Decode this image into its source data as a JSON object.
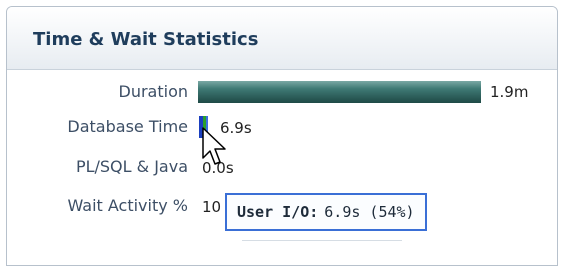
{
  "panel": {
    "title": "Time & Wait Statistics",
    "rows": [
      {
        "label": "Duration",
        "value": "1.9m",
        "bar_fraction": 1.0
      },
      {
        "label": "Database Time",
        "value": "6.9s"
      },
      {
        "label": "PL/SQL & Java",
        "value": "0.0s"
      },
      {
        "label": "Wait Activity %",
        "value": "10"
      }
    ]
  },
  "tooltip": {
    "key": "User I/O:",
    "value": "6.9s (54%)"
  },
  "colors": {
    "title": "#1f3d5c",
    "label": "#3d4f66",
    "duration_bar": "#2d5f5b",
    "dbtime_bar_primary": "#1b3fbf",
    "dbtime_bar_secondary": "#2aa02a",
    "tooltip_border": "#3a6fd6"
  },
  "icons": [
    "mouse-pointer-icon"
  ]
}
